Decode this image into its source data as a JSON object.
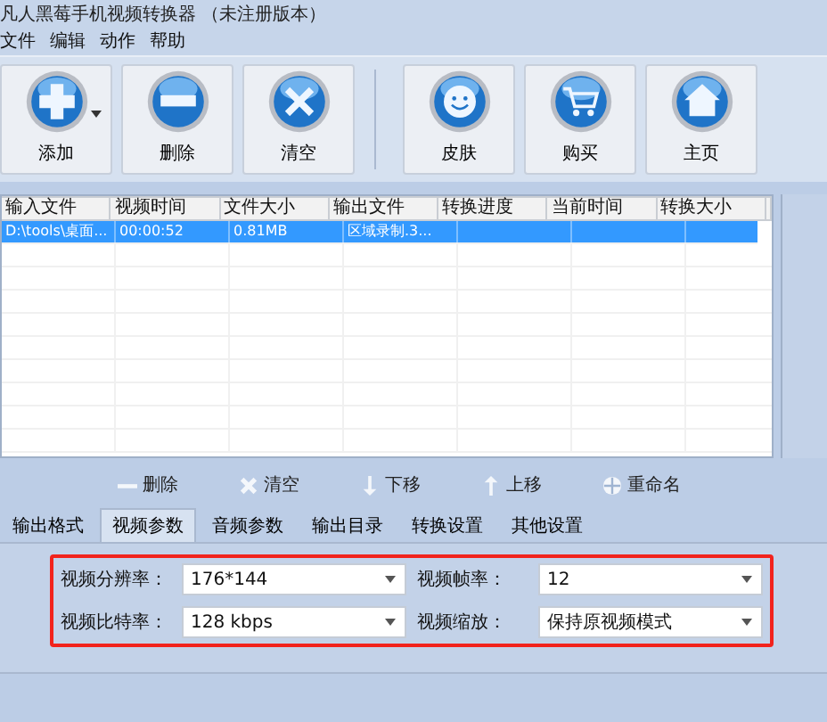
{
  "window": {
    "title": "凡人黑莓手机视频转换器 （未注册版本）"
  },
  "menu": [
    "文件",
    "编辑",
    "动作",
    "帮助"
  ],
  "toolbar": [
    {
      "label": "添加",
      "kind": "add",
      "dropdown": true
    },
    {
      "label": "删除",
      "kind": "remove",
      "dropdown": false
    },
    {
      "label": "清空",
      "kind": "clear",
      "dropdown": false
    },
    {
      "label": "皮肤",
      "kind": "skin",
      "dropdown": false
    },
    {
      "label": "购买",
      "kind": "buy",
      "dropdown": false
    },
    {
      "label": "主页",
      "kind": "home",
      "dropdown": false
    }
  ],
  "table": {
    "columns": [
      "输入文件",
      "视频时间",
      "文件大小",
      "输出文件",
      "转换进度",
      "当前时间",
      "转换大小"
    ],
    "rows": [
      {
        "selected": true,
        "cells": [
          "D:\\tools\\桌面...",
          "00:00:52",
          "0.81MB",
          "区域录制.3...",
          "",
          "",
          ""
        ]
      }
    ]
  },
  "actions": [
    {
      "label": "删除",
      "kind": "remove"
    },
    {
      "label": "清空",
      "kind": "clear"
    },
    {
      "label": "下移",
      "kind": "down"
    },
    {
      "label": "上移",
      "kind": "up"
    },
    {
      "label": "重命名",
      "kind": "rename"
    }
  ],
  "tabs": [
    {
      "label": "输出格式",
      "selected": false
    },
    {
      "label": "视频参数",
      "selected": true
    },
    {
      "label": "音频参数",
      "selected": false
    },
    {
      "label": "输出目录",
      "selected": false
    },
    {
      "label": "转换设置",
      "selected": false
    },
    {
      "label": "其他设置",
      "selected": false
    }
  ],
  "settings": [
    {
      "label": "视频分辨率：",
      "value": "176*144"
    },
    {
      "label": "视频帧率：",
      "value": "12"
    },
    {
      "label": "视频比特率：",
      "value": "128 kbps"
    },
    {
      "label": "视频缩放：",
      "value": "保持原视频模式"
    }
  ]
}
